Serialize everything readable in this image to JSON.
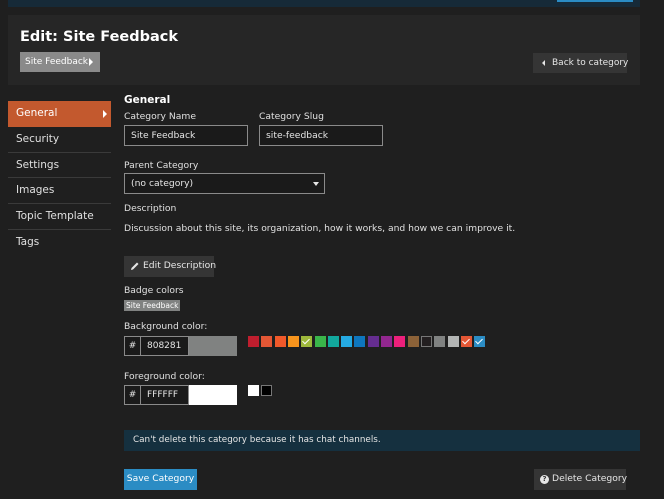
{
  "header": {
    "title": "Edit: Site Feedback",
    "breadcrumb": "Site Feedback",
    "back_label": "Back to category"
  },
  "sidebar": {
    "items": [
      {
        "label": "General",
        "active": true
      },
      {
        "label": "Security"
      },
      {
        "label": "Settings"
      },
      {
        "label": "Images"
      },
      {
        "label": "Topic Template"
      },
      {
        "label": "Tags"
      }
    ]
  },
  "general": {
    "section_title": "General",
    "category_name_label": "Category Name",
    "category_name_value": "Site Feedback",
    "category_slug_label": "Category Slug",
    "category_slug_value": "site-feedback",
    "parent_category_label": "Parent Category",
    "parent_category_value": "(no category)",
    "description_label": "Description",
    "description_text": "Discussion about this site, its organization, how it works, and how we can improve it.",
    "edit_description_label": "Edit Description"
  },
  "badge": {
    "badge_colors_label": "Badge colors",
    "badge_preview": "Site Feedback",
    "background_label": "Background color:",
    "background_value": "808281",
    "background_color": "#808281",
    "foreground_label": "Foreground color:",
    "foreground_value": "FFFFFF",
    "foreground_color": "#FFFFFF",
    "hash": "#",
    "bg_swatches": [
      "#BF1E2E",
      "#E45735",
      "#F1592A",
      "#F7941D",
      "#9EB83B",
      "#3AB54A",
      "#12A89D",
      "#25AAE2",
      "#0E76BD",
      "#652D90",
      "#92278F",
      "#ED207B",
      "#8C6238",
      "#231F20",
      "#808281",
      "#B3B5B4",
      "#E45735",
      "#2B8CC4"
    ],
    "fg_swatches": [
      "#FFFFFF",
      "#000000"
    ]
  },
  "alert": {
    "text": "Can't delete this category because it has chat channels."
  },
  "footer": {
    "save_label": "Save Category",
    "delete_label": "Delete Category"
  },
  "colors": {
    "accent": "#C3592E",
    "primary": "#2B8CC4"
  },
  "icons": [
    "caret-right-icon",
    "chevron-left-icon",
    "pencil-icon",
    "caret-down-icon",
    "check-icon",
    "question-circle-icon"
  ]
}
